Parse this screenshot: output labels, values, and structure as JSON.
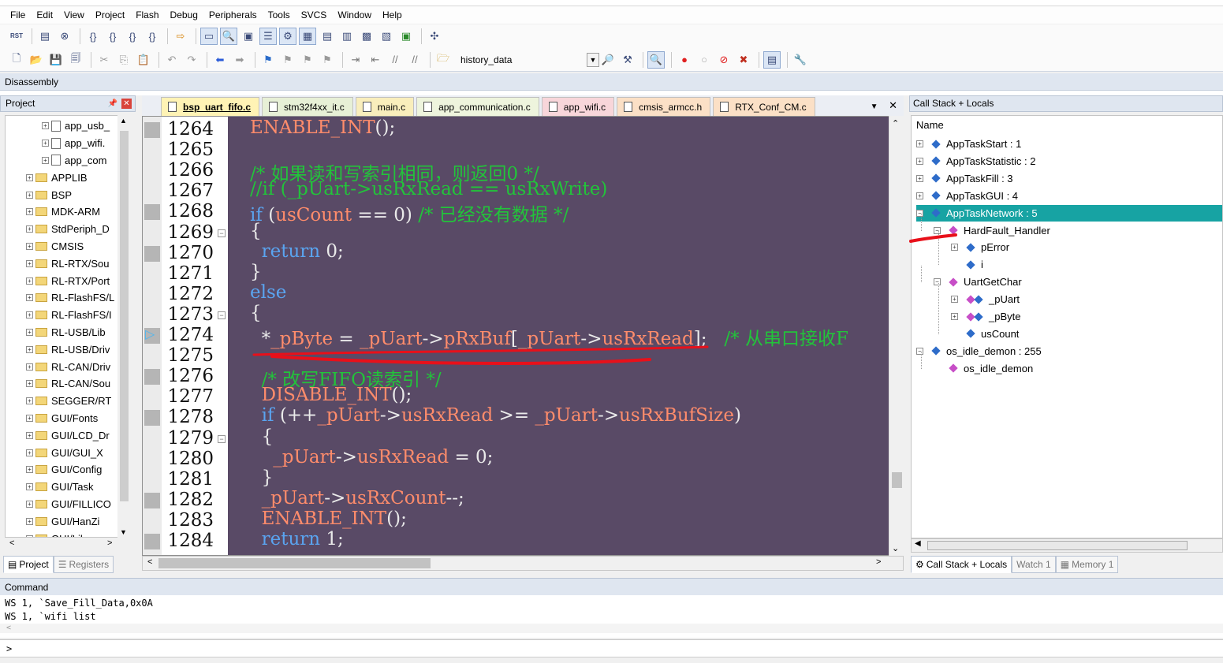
{
  "menu": [
    "File",
    "Edit",
    "View",
    "Project",
    "Flash",
    "Debug",
    "Peripherals",
    "Tools",
    "SVCS",
    "Window",
    "Help"
  ],
  "toolbar": {
    "rst_label": "RST",
    "combo_value": "history_data"
  },
  "disassembly": {
    "title": "Disassembly"
  },
  "project": {
    "title": "Project",
    "tree": [
      {
        "label": "app_usb_",
        "type": "file"
      },
      {
        "label": "app_wifi.",
        "type": "file"
      },
      {
        "label": "app_com",
        "type": "file"
      },
      {
        "label": "APPLIB",
        "type": "folder"
      },
      {
        "label": "BSP",
        "type": "folder"
      },
      {
        "label": "MDK-ARM",
        "type": "folder"
      },
      {
        "label": "StdPeriph_D",
        "type": "folder"
      },
      {
        "label": "CMSIS",
        "type": "folder"
      },
      {
        "label": "RL-RTX/Sou",
        "type": "folder"
      },
      {
        "label": "RL-RTX/Port",
        "type": "folder"
      },
      {
        "label": "RL-FlashFS/L",
        "type": "folder"
      },
      {
        "label": "RL-FlashFS/I",
        "type": "folder"
      },
      {
        "label": "RL-USB/Lib",
        "type": "folder"
      },
      {
        "label": "RL-USB/Driv",
        "type": "folder"
      },
      {
        "label": "RL-CAN/Driv",
        "type": "folder"
      },
      {
        "label": "RL-CAN/Sou",
        "type": "folder"
      },
      {
        "label": "SEGGER/RT",
        "type": "folder"
      },
      {
        "label": "GUI/Fonts",
        "type": "folder"
      },
      {
        "label": "GUI/LCD_Dr",
        "type": "folder"
      },
      {
        "label": "GUI/GUI_X",
        "type": "folder"
      },
      {
        "label": "GUI/Config",
        "type": "folder"
      },
      {
        "label": "GUI/Task",
        "type": "folder"
      },
      {
        "label": "GUI/FILLICO",
        "type": "folder"
      },
      {
        "label": "GUI/HanZi",
        "type": "folder"
      },
      {
        "label": "GUI/Lib",
        "type": "folder"
      }
    ],
    "tabs": [
      "Project",
      "Registers"
    ]
  },
  "editor": {
    "tabs": [
      {
        "label": "bsp_uart_fifo.c",
        "style": "active"
      },
      {
        "label": "stm32f4xx_it.c",
        "style": "c-green"
      },
      {
        "label": "main.c",
        "style": "c-yellow"
      },
      {
        "label": "app_communication.c",
        "style": "c-lgreen"
      },
      {
        "label": "app_wifi.c",
        "style": "c-pink"
      },
      {
        "label": "cmsis_armcc.h",
        "style": "c-peach"
      },
      {
        "label": "RTX_Conf_CM.c",
        "style": "c-peach"
      }
    ],
    "line_numbers": [
      "1264",
      "1265",
      "1266",
      "1267",
      "1268",
      "1269",
      "1270",
      "1271",
      "1272",
      "1273",
      "1274",
      "1275",
      "1276",
      "1277",
      "1278",
      "1279",
      "1280",
      "1281",
      "1282",
      "1283",
      "1284"
    ],
    "current_line": "1274",
    "lines": [
      [
        [
          "c-macro",
          "ENABLE_INT"
        ],
        [
          "c-txt",
          "();"
        ]
      ],
      [],
      [
        [
          "c-comment",
          "/* 如果读和写索引相同，则返回0 */"
        ]
      ],
      [
        [
          "c-comment",
          "//if (_pUart->usRxRead == usRxWrite)"
        ]
      ],
      [
        [
          "c-kw",
          "if "
        ],
        [
          "c-txt",
          "("
        ],
        [
          "c-ident",
          "usCount"
        ],
        [
          "c-txt",
          " == 0) "
        ],
        [
          "c-comment",
          "/* 已经没有数据 */"
        ]
      ],
      [
        [
          "c-txt",
          "{"
        ]
      ],
      [
        [
          "c-kw",
          "  return "
        ],
        [
          "c-txt",
          "0;"
        ]
      ],
      [
        [
          "c-txt",
          "}"
        ]
      ],
      [
        [
          "c-kw",
          "else"
        ]
      ],
      [
        [
          "c-txt",
          "{"
        ]
      ],
      [
        [
          "c-txt",
          "  *"
        ],
        [
          "c-ident",
          "_pByte"
        ],
        [
          "c-txt",
          " = "
        ],
        [
          "c-ident",
          "_pUart"
        ],
        [
          "c-txt",
          "->"
        ],
        [
          "c-ident",
          "pRxBuf"
        ],
        [
          "c-txt",
          "["
        ],
        [
          "c-ident",
          "_pUart"
        ],
        [
          "c-txt",
          "->"
        ],
        [
          "c-ident",
          "usRxRead"
        ],
        [
          "c-txt",
          "];   "
        ],
        [
          "c-comment",
          "/* 从串口接收F"
        ]
      ],
      [],
      [
        [
          "c-comment",
          "  /* 改写FIFO读索引 */"
        ]
      ],
      [
        [
          "c-macro",
          "  DISABLE_INT"
        ],
        [
          "c-txt",
          "();"
        ]
      ],
      [
        [
          "c-kw",
          "  if "
        ],
        [
          "c-txt",
          "(++"
        ],
        [
          "c-ident",
          "_pUart"
        ],
        [
          "c-txt",
          "->"
        ],
        [
          "c-ident",
          "usRxRead"
        ],
        [
          "c-txt",
          " >= "
        ],
        [
          "c-ident",
          "_pUart"
        ],
        [
          "c-txt",
          "->"
        ],
        [
          "c-ident",
          "usRxBufSize"
        ],
        [
          "c-txt",
          ")"
        ]
      ],
      [
        [
          "c-txt",
          "  {"
        ]
      ],
      [
        [
          "c-ident",
          "    _pUart"
        ],
        [
          "c-txt",
          "->"
        ],
        [
          "c-ident",
          "usRxRead"
        ],
        [
          "c-txt",
          " = 0;"
        ]
      ],
      [
        [
          "c-txt",
          "  }"
        ]
      ],
      [
        [
          "c-ident",
          "  _pUart"
        ],
        [
          "c-txt",
          "->"
        ],
        [
          "c-ident",
          "usRxCount"
        ],
        [
          "c-txt",
          "--;"
        ]
      ],
      [
        [
          "c-macro",
          "  ENABLE_INT"
        ],
        [
          "c-txt",
          "();"
        ]
      ],
      [
        [
          "c-kw",
          "  return "
        ],
        [
          "c-txt",
          "1;"
        ]
      ]
    ]
  },
  "callstack": {
    "title": "Call Stack + Locals",
    "column": "Name",
    "rows": [
      {
        "label": "AppTaskStart : 1",
        "indent": 0,
        "exp": "+",
        "icon": "b"
      },
      {
        "label": "AppTaskStatistic : 2",
        "indent": 0,
        "exp": "+",
        "icon": "b"
      },
      {
        "label": "AppTaskFill : 3",
        "indent": 0,
        "exp": "+",
        "icon": "b"
      },
      {
        "label": "AppTaskGUI : 4",
        "indent": 0,
        "exp": "+",
        "icon": "b"
      },
      {
        "label": "AppTaskNetwork : 5",
        "indent": 0,
        "exp": "-",
        "icon": "b",
        "selected": true
      },
      {
        "label": "HardFault_Handler",
        "indent": 1,
        "exp": "-",
        "icon": "p"
      },
      {
        "label": "pError",
        "indent": 2,
        "exp": "+",
        "icon": "b"
      },
      {
        "label": "i",
        "indent": 2,
        "exp": "",
        "icon": "b"
      },
      {
        "label": "UartGetChar",
        "indent": 1,
        "exp": "-",
        "icon": "p"
      },
      {
        "label": "_pUart",
        "indent": 2,
        "exp": "+",
        "icon": "pb"
      },
      {
        "label": "_pByte",
        "indent": 2,
        "exp": "+",
        "icon": "pb"
      },
      {
        "label": "usCount",
        "indent": 2,
        "exp": "",
        "icon": "b"
      },
      {
        "label": "os_idle_demon : 255",
        "indent": 0,
        "exp": "-",
        "icon": "b"
      },
      {
        "label": "os_idle_demon",
        "indent": 1,
        "exp": "",
        "icon": "p"
      }
    ],
    "tabs": [
      "Call Stack + Locals",
      "Watch 1",
      "Memory 1"
    ]
  },
  "command": {
    "title": "Command",
    "lines": [
      "WS 1, `Save_Fill_Data,0x0A",
      "WS 1, `wifi list"
    ],
    "prompt": ">"
  }
}
